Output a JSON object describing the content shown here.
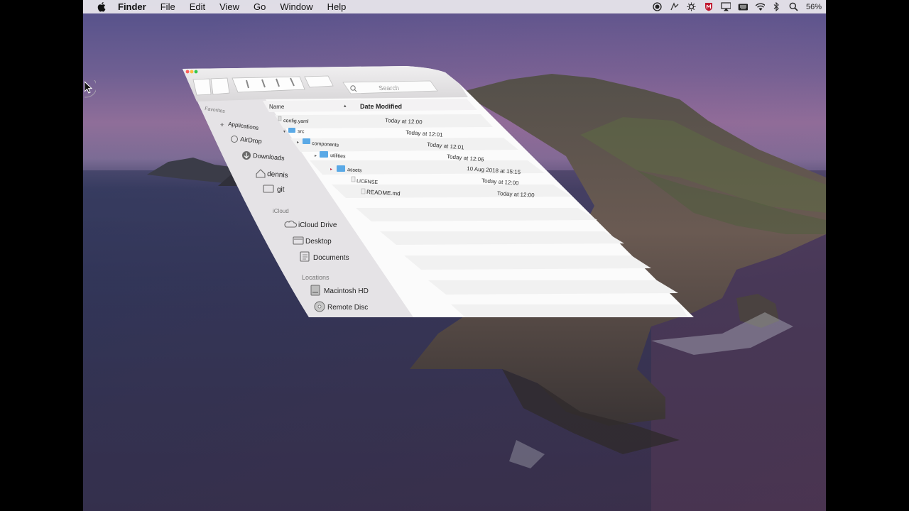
{
  "menubar": {
    "app_name": "Finder",
    "items": [
      "File",
      "Edit",
      "View",
      "Go",
      "Window",
      "Help"
    ],
    "battery": "56%"
  },
  "finder": {
    "search_placeholder": "Search",
    "columns": {
      "name": "Name",
      "modified": "Date Modified"
    },
    "sidebar": {
      "favorites_header": "Favorites",
      "favorites": [
        "Applications",
        "AirDrop",
        "Downloads",
        "dennis",
        "git"
      ],
      "icloud_header": "iCloud",
      "icloud": [
        "iCloud Drive",
        "Desktop",
        "Documents"
      ],
      "locations_header": "Locations",
      "locations": [
        "Macintosh HD",
        "Remote Disc"
      ]
    },
    "files": [
      {
        "name": "config.yaml",
        "modified": "Today at 12:00"
      },
      {
        "name": "src",
        "modified": "Today at 12:01"
      },
      {
        "name": "components",
        "modified": "Today at 12:01"
      },
      {
        "name": "utilities",
        "modified": "Today at 12:06"
      },
      {
        "name": "assets",
        "modified": "10 Aug 2018 at 15:15"
      },
      {
        "name": "LICENSE",
        "modified": "Today at 12:00"
      },
      {
        "name": "README.md",
        "modified": "Today at 12:00"
      }
    ]
  }
}
